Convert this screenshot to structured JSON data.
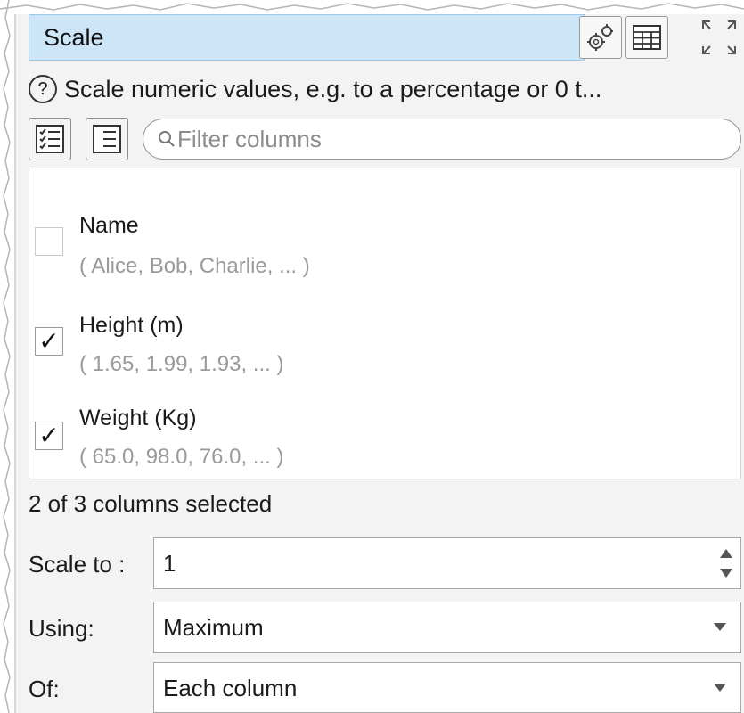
{
  "header": {
    "title": "Scale"
  },
  "description": {
    "text": "Scale numeric values, e.g. to a percentage or 0 t..."
  },
  "filter": {
    "placeholder": "Filter columns"
  },
  "columns": [
    {
      "name": "Name",
      "sample": "( Alice, Bob, Charlie, ... )",
      "checked": false
    },
    {
      "name": "Height (m)",
      "sample": "( 1.65, 1.99, 1.93, ... )",
      "checked": true
    },
    {
      "name": "Weight (Kg)",
      "sample": "( 65.0, 98.0, 76.0, ... )",
      "checked": true
    }
  ],
  "selection_count": "2 of 3 columns selected",
  "scale_to": {
    "label": "Scale to :",
    "value": "1"
  },
  "using": {
    "label": "Using:",
    "value": "Maximum"
  },
  "of": {
    "label": "Of:",
    "value": "Each column"
  },
  "icons": {
    "help": "help-icon",
    "settings": "gears-icon",
    "table": "table-icon",
    "maximize": "maximize-icon",
    "select_all": "checklist-icon",
    "deselect": "list-icon",
    "search": "search-icon"
  },
  "colors": {
    "title_bg": "#cde6f7",
    "panel_bg": "#f3f3f3"
  }
}
